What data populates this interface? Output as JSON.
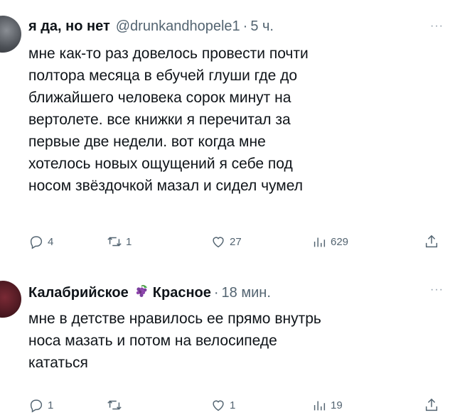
{
  "tweets": [
    {
      "display_name": "я да, но нет",
      "handle": "@drunkandhopele1",
      "separator": "·",
      "time": "5 ч.",
      "more": "···",
      "text": "мне как-то раз довелось провести почти\nполтора месяца в ебучей глуши где до\nближайшего человека сорок минут на\nвертолете. все книжки я перечитал за\nпервые две недели. вот когда мне\nхотелось новых ощущений я себе под\nносом звёздочкой мазал и сидел чумел",
      "stats": {
        "replies": "4",
        "reposts": "1",
        "likes": "27",
        "views": "629"
      }
    },
    {
      "display_name_part1": "Калабрийское",
      "display_name_part2": "Красное",
      "name_emoji": "grape-icon",
      "separator": "·",
      "time": "18 мин.",
      "more": "···",
      "text": "мне в детстве нравилось ее прямо внутрь\nноса мазать и потом на велосипеде\nкататься",
      "stats": {
        "replies": "1",
        "reposts": "",
        "likes": "1",
        "views": "19"
      }
    }
  ],
  "colors": {
    "text": "#0f1419",
    "secondary": "#536471",
    "background": "#ffffff"
  }
}
